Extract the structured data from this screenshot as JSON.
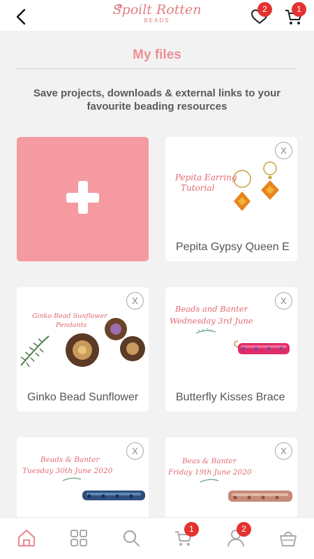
{
  "header": {
    "logo_main": "Spoilt Rotten",
    "logo_sub": "BEADS",
    "wishlist_badge": "2",
    "cart_badge": "1"
  },
  "page": {
    "title": "My files",
    "subtitle": "Save projects, downloads & external links to your favourite beading resources"
  },
  "files": [
    {
      "label": "Pepita Gypsy Queen E",
      "image_caption": [
        "Pepita Earring",
        "Tutorial"
      ],
      "close": "X"
    },
    {
      "label": "Ginko Bead Sunflower",
      "image_caption": [
        "Ginko Bead Sunflower",
        "Pendants"
      ],
      "close": "X"
    },
    {
      "label": "Butterfly Kisses Brace",
      "image_caption": [
        "Beads and Banter",
        "Wednesday 3rd June"
      ],
      "close": "X"
    },
    {
      "label": "",
      "image_caption": [
        "Beads & Banter",
        "Tuesday 30th June 2020"
      ],
      "close": "X"
    },
    {
      "label": "",
      "image_caption": [
        "Beas & Banter",
        "Friday 19th June 2020"
      ],
      "close": "X"
    }
  ],
  "tabbar": {
    "cart_badge": "1",
    "account_badge": "2"
  },
  "colors": {
    "accent": "#f49aa0",
    "title": "#ee8f95",
    "badge": "#e3322f"
  }
}
